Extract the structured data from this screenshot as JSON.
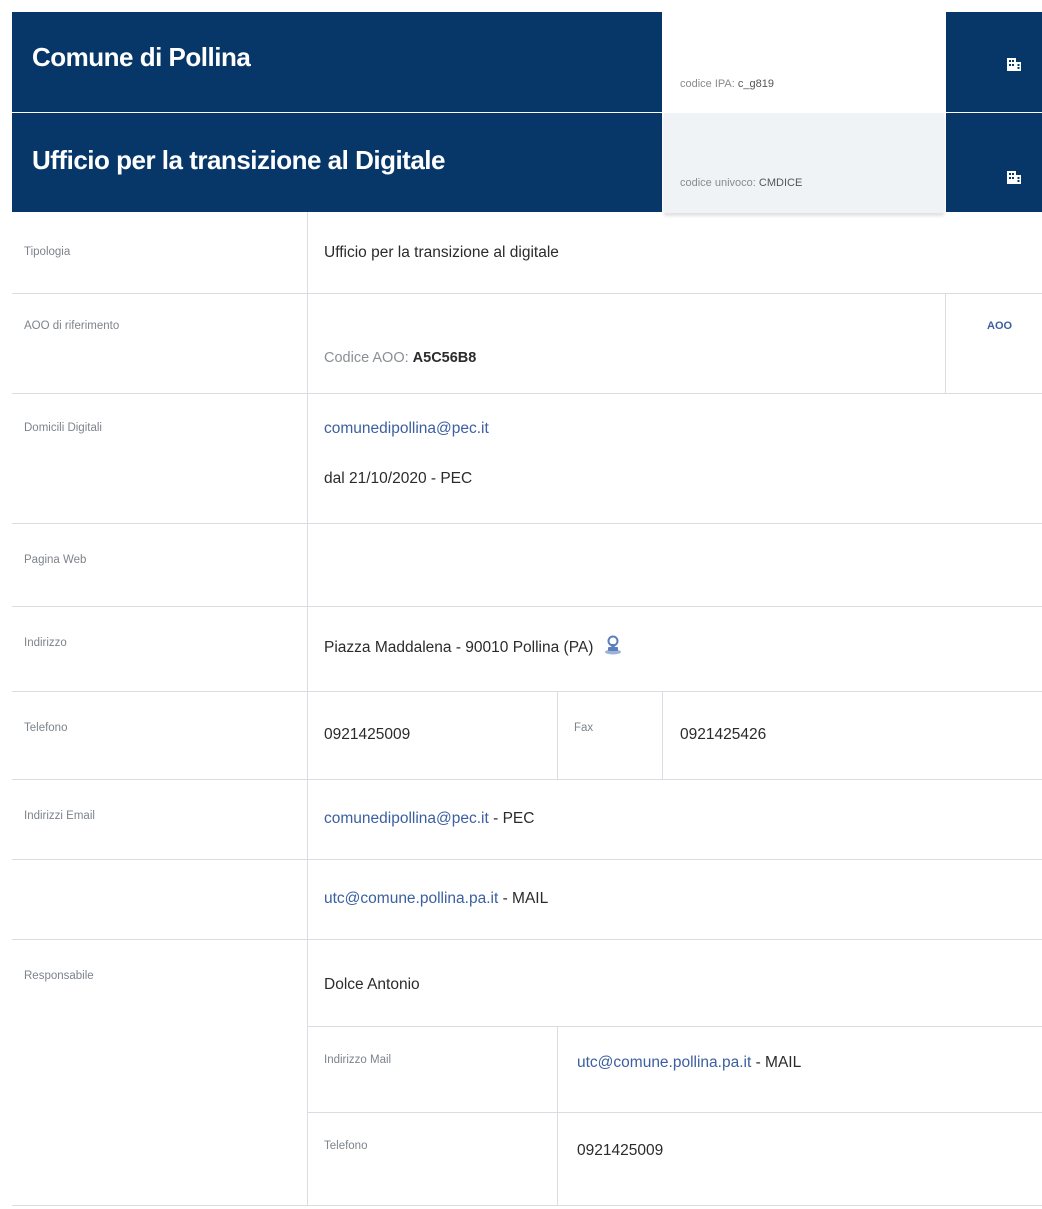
{
  "header": {
    "org_name": "Comune di Pollina",
    "org_code_label": "codice IPA:",
    "org_code_value": "c_g819",
    "office_name": "Ufficio per la transizione al Digitale",
    "office_code_label": "codice univoco:",
    "office_code_value": "CMDICE",
    "icons": [
      "building-icon",
      "building-icon"
    ]
  },
  "details": {
    "tipologia": {
      "label": "Tipologia",
      "value": "Ufficio per la transizione al digitale"
    },
    "aoo": {
      "label": "AOO di riferimento",
      "code_label": "Codice AOO:",
      "code_value": "A5C56B8",
      "tag": "AOO"
    },
    "domicili": {
      "label": "Domicili Digitali",
      "email": "comunedipollina@pec.it",
      "since": "dal 21/10/2020 - PEC"
    },
    "web": {
      "label": "Pagina Web",
      "value": ""
    },
    "indirizzo": {
      "label": "Indirizzo",
      "value": "Piazza Maddalena - 90010 Pollina (PA)",
      "icon": "map-pin-icon"
    },
    "telefono": {
      "label": "Telefono",
      "value": "0921425009",
      "fax_label": "Fax",
      "fax_value": "0921425426"
    },
    "emails": {
      "label": "Indirizzi Email",
      "items": [
        {
          "address": "comunedipollina@pec.it",
          "type": "- PEC"
        },
        {
          "address": "utc@comune.pollina.pa.it",
          "type": "- MAIL"
        }
      ]
    },
    "responsabile": {
      "label": "Responsabile",
      "name": "Dolce Antonio",
      "mail_label": "Indirizzo Mail",
      "mail_address": "utc@comune.pollina.pa.it",
      "mail_type": "- MAIL",
      "phone_label": "Telefono",
      "phone_value": "0921425009"
    }
  },
  "colors": {
    "header_bg": "#073769",
    "link": "#3b5fa0",
    "divider": "#d9dde2"
  }
}
